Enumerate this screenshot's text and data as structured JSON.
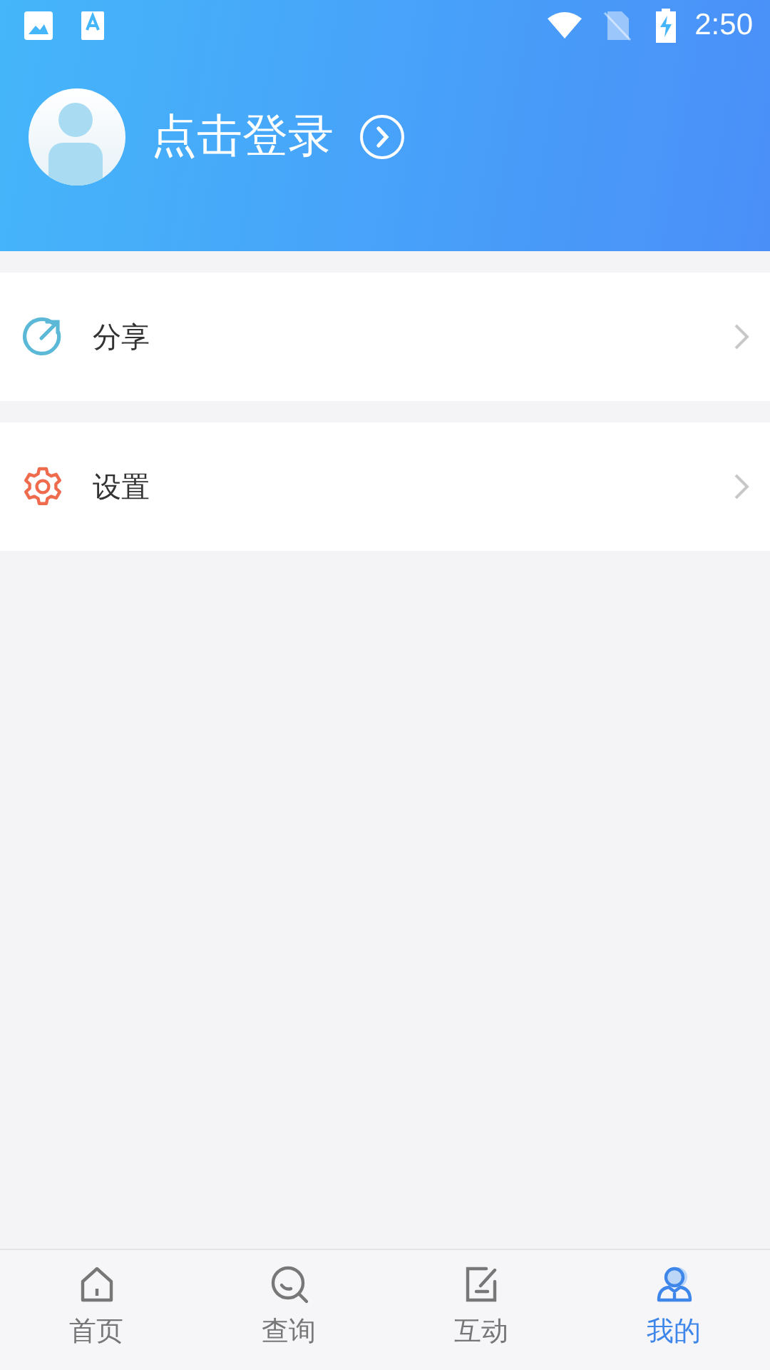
{
  "status_bar": {
    "time": "2:50"
  },
  "profile": {
    "login_label": "点击登录"
  },
  "menu": [
    {
      "kind": "share",
      "label": "分享"
    },
    {
      "kind": "settings",
      "label": "设置"
    }
  ],
  "tabs": [
    {
      "kind": "home",
      "label": "首页",
      "selected": false
    },
    {
      "kind": "search",
      "label": "查询",
      "selected": false
    },
    {
      "kind": "edit",
      "label": "互动",
      "selected": false
    },
    {
      "kind": "person",
      "label": "我的",
      "selected": true
    }
  ]
}
